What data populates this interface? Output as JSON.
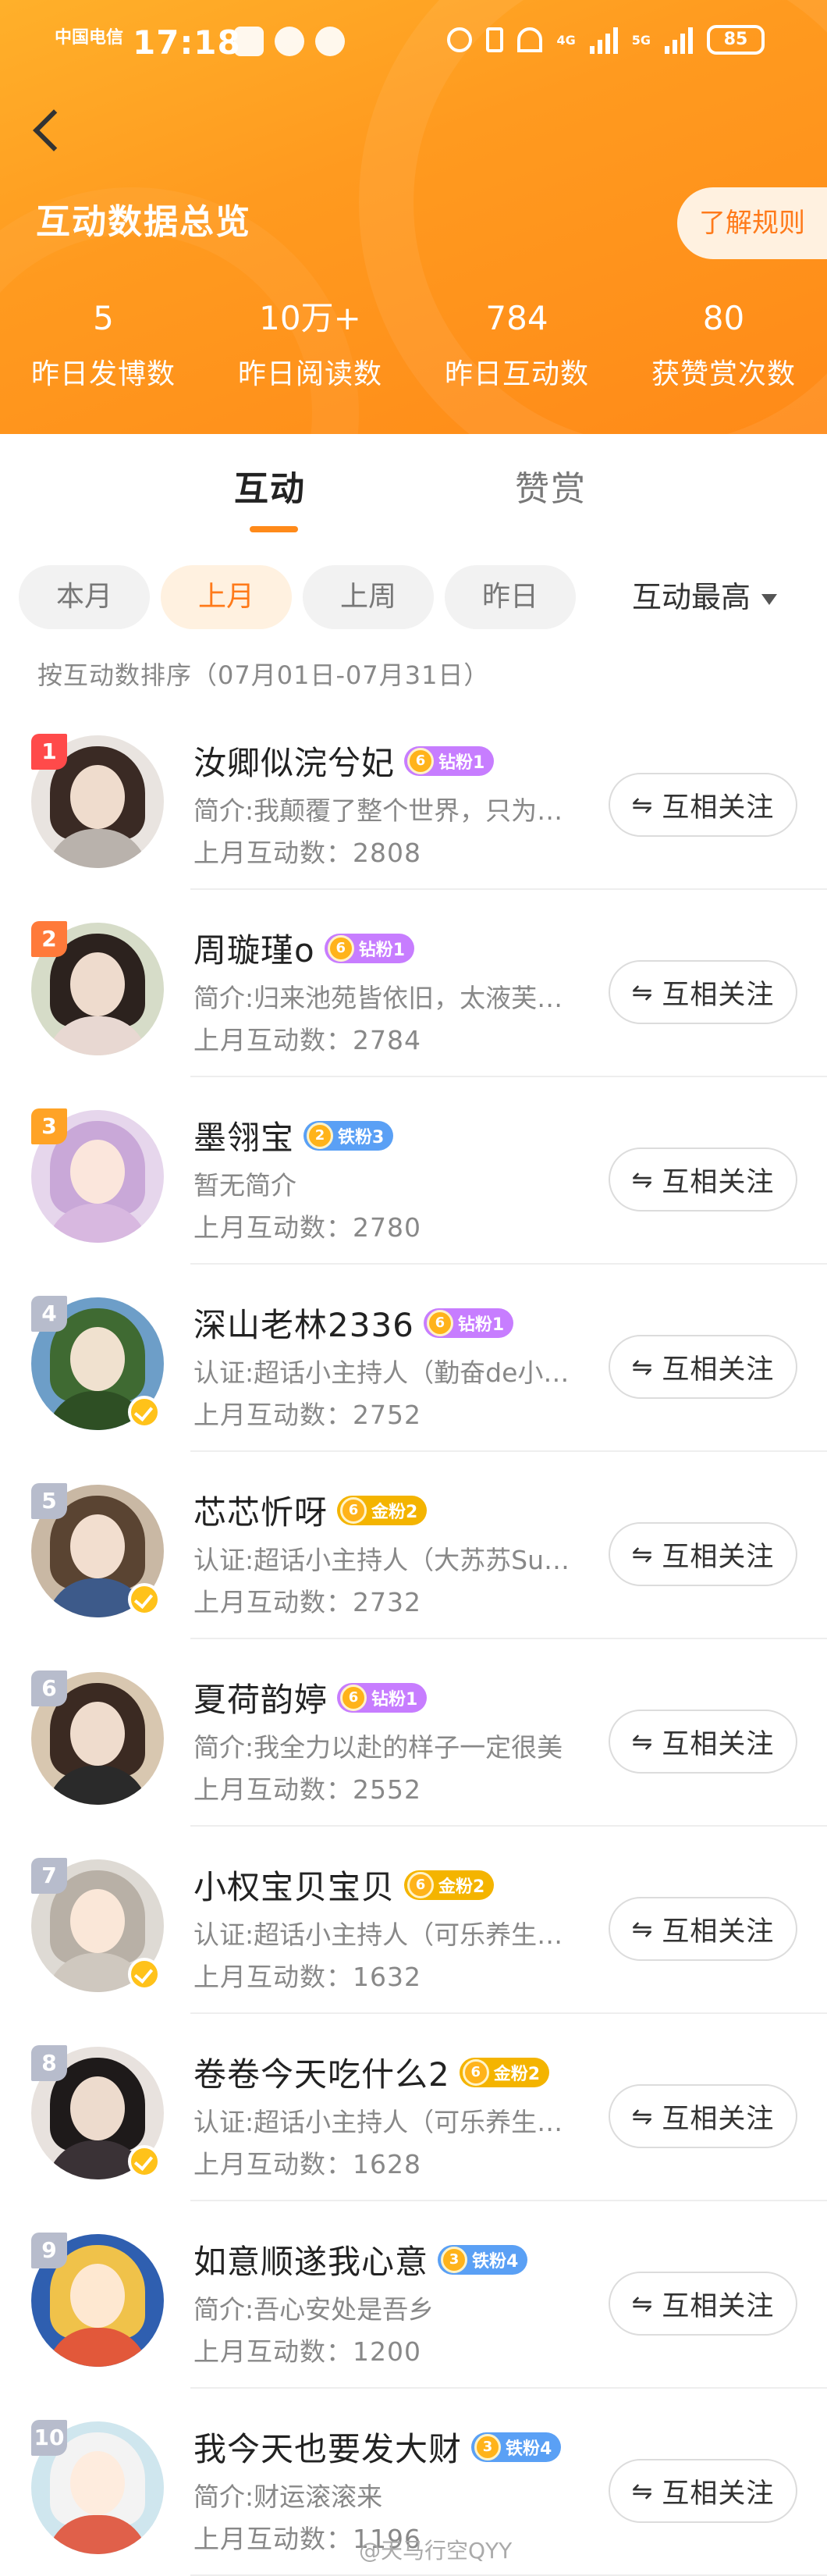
{
  "status_bar": {
    "carrier": "中国电信",
    "time": "17:18",
    "network_tags": [
      "4G",
      "5G"
    ],
    "battery": "85"
  },
  "header": {
    "title": "互动数据总览",
    "rules_button": "了解规则",
    "stats": [
      {
        "value": "5",
        "label": "昨日发博数"
      },
      {
        "value": "10万+",
        "label": "昨日阅读数"
      },
      {
        "value": "784",
        "label": "昨日互动数"
      },
      {
        "value": "80",
        "label": "获赞赏次数"
      }
    ]
  },
  "tabs": {
    "interact": "互动",
    "reward": "赞赏",
    "active": "互动"
  },
  "filters": {
    "chips": [
      "本月",
      "上月",
      "上周",
      "昨日"
    ],
    "active": "上月",
    "sort_dropdown": "互动最高"
  },
  "sort_note": "按互动数排序（07月01日-07月31日）",
  "follow_label": "互相关注",
  "colors": {
    "header_orange": "#ff9a1f",
    "accent": "#ff7a1a",
    "diamond_badge": "#c77dff",
    "iron_badge": "#5aa0f5",
    "gold_badge": "#f4b400",
    "verified": "#ffc21a"
  },
  "users": [
    {
      "rank": "1",
      "name": "汝卿似浣兮妃",
      "badge_level": "6",
      "badge": "钻粉1",
      "badge_type": "diamond",
      "bio": "简介:我颠覆了整个世界，只为摆正你的倒影",
      "count": "上月互动数：2808",
      "verified": false,
      "avatar": {
        "bg": "#e9e4e0",
        "hair": "#3a2a24",
        "body": "#b9b2ac"
      }
    },
    {
      "rank": "2",
      "name": "周璇瑾o",
      "badge_level": "6",
      "badge": "钻粉1",
      "badge_type": "diamond",
      "bio": "简介:归来池苑皆依旧，太液芙蓉未央柳",
      "count": "上月互动数：2784",
      "verified": false,
      "avatar": {
        "bg": "#d6dcc8",
        "hair": "#2c221e",
        "body": "#e8d8d2"
      }
    },
    {
      "rank": "3",
      "name": "墨翎宝",
      "badge_level": "2",
      "badge": "铁粉3",
      "badge_type": "iron",
      "bio": "暂无简介",
      "count": "上月互动数：2780",
      "verified": false,
      "avatar": {
        "bg": "#e6d6ec",
        "hair": "#c9a8d8",
        "body": "#d8b8e0"
      }
    },
    {
      "rank": "4",
      "name": "深山老林2336",
      "badge_level": "6",
      "badge": "钻粉1",
      "badge_type": "diamond",
      "bio": "认证:超话小主持人（勤奋de小蜜蜂超话）",
      "count": "上月互动数：2752",
      "verified": true,
      "avatar": {
        "bg": "#6d9ec8",
        "hair": "#3f6a32",
        "body": "#2e4f24"
      }
    },
    {
      "rank": "5",
      "name": "芯芯忻呀",
      "badge_level": "6",
      "badge": "金粉2",
      "badge_type": "gold",
      "bio": "认证:超话小主持人（大苏苏Sunny超话）",
      "count": "上月互动数：2732",
      "verified": true,
      "avatar": {
        "bg": "#c9b8a4",
        "hair": "#5a4432",
        "body": "#3d5a8a"
      }
    },
    {
      "rank": "6",
      "name": "夏荷韵婷",
      "badge_level": "6",
      "badge": "钻粉1",
      "badge_type": "diamond",
      "bio": "简介:我全力以赴的样子一定很美",
      "count": "上月互动数：2552",
      "verified": false,
      "avatar": {
        "bg": "#d8c7b0",
        "hair": "#3b2a22",
        "body": "#2a2a2a"
      }
    },
    {
      "rank": "7",
      "name": "小权宝贝宝贝",
      "badge_level": "6",
      "badge": "金粉2",
      "badge_type": "gold",
      "bio": "认证:超话小主持人（可乐养生堂超话）",
      "count": "上月互动数：1632",
      "verified": true,
      "avatar": {
        "bg": "#dedad4",
        "hair": "#b8b0a6",
        "body": "#cfc8bf"
      }
    },
    {
      "rank": "8",
      "name": "卷卷今天吃什么2",
      "badge_level": "6",
      "badge": "金粉2",
      "badge_type": "gold",
      "bio": "认证:超话小主持人（可乐养生堂超话）",
      "count": "上月互动数：1628",
      "verified": true,
      "avatar": {
        "bg": "#e8e2de",
        "hair": "#1e1a1a",
        "body": "#3a3236"
      }
    },
    {
      "rank": "9",
      "name": "如意顺遂我心意",
      "badge_level": "3",
      "badge": "铁粉4",
      "badge_type": "iron",
      "bio": "简介:吾心安处是吾乡",
      "count": "上月互动数：1200",
      "verified": false,
      "avatar": {
        "bg": "#2f5fb0",
        "hair": "#f0c24a",
        "body": "#e2583a"
      }
    },
    {
      "rank": "10",
      "name": "我今天也要发大财",
      "badge_level": "3",
      "badge": "铁粉4",
      "badge_type": "iron",
      "bio": "简介:财运滚滚来",
      "count": "上月互动数：1196",
      "verified": false,
      "avatar": {
        "bg": "#cfe6ee",
        "hair": "#f3f3f3",
        "body": "#e0604a"
      }
    }
  ],
  "watermark": "@天马行空QYY"
}
